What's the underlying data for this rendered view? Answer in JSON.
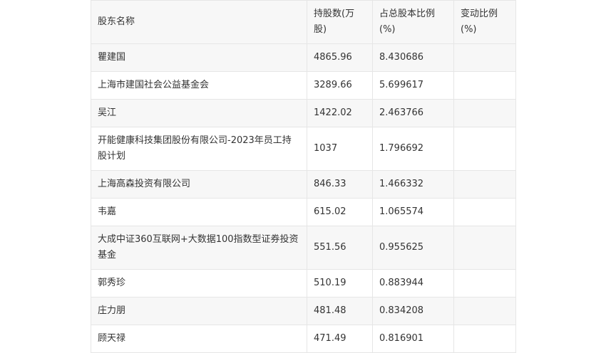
{
  "table": {
    "headers": [
      "股东名称",
      "持股数(万股)",
      "占总股本比例(%)",
      "变动比例(%)"
    ],
    "rows": [
      [
        "瞿建国",
        "4865.96",
        "8.430686",
        ""
      ],
      [
        "上海市建国社会公益基金会",
        "3289.66",
        "5.699617",
        ""
      ],
      [
        "吴江",
        "1422.02",
        "2.463766",
        ""
      ],
      [
        "开能健康科技集团股份有限公司-2023年员工持股计划",
        "1037",
        "1.796692",
        ""
      ],
      [
        "上海高森投资有限公司",
        "846.33",
        "1.466332",
        ""
      ],
      [
        "韦嘉",
        "615.02",
        "1.065574",
        ""
      ],
      [
        "大成中证360互联网+大数据100指数型证券投资基金",
        "551.56",
        "0.955625",
        ""
      ],
      [
        "郭秀珍",
        "510.19",
        "0.883944",
        ""
      ],
      [
        "庄力朋",
        "481.48",
        "0.834208",
        ""
      ],
      [
        "顾天禄",
        "471.49",
        "0.816901",
        ""
      ]
    ]
  }
}
